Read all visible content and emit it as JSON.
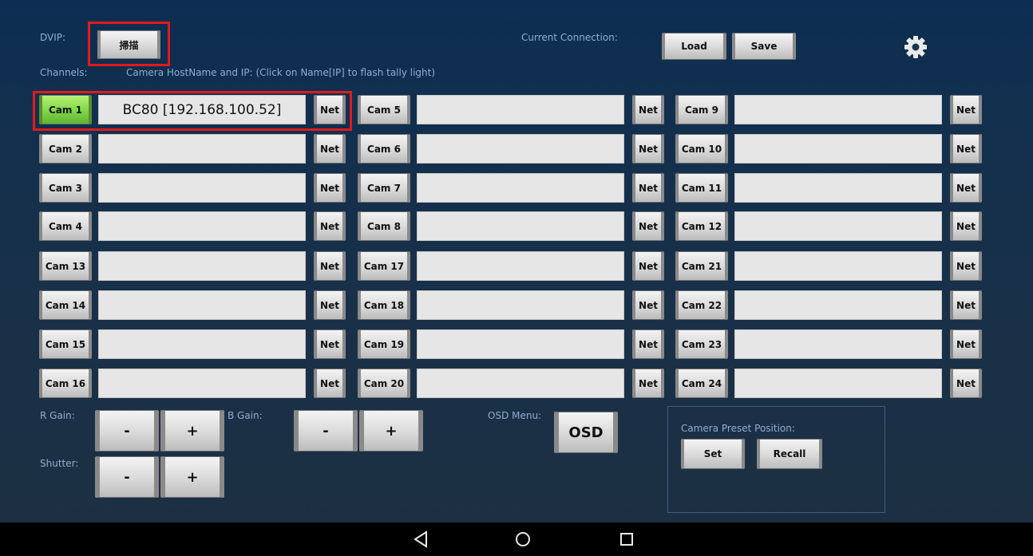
{
  "top": {
    "dvip_label": "DVIP:",
    "scan_label": "掃描",
    "current_connection_label": "Current Connection:",
    "load_label": "Load",
    "save_label": "Save",
    "channels_label": "Channels:",
    "hint_text": "Camera HostName and IP: (Click on Name[IP] to flash tally light)",
    "settings_icon": "gear-icon"
  },
  "net_label": "Net",
  "cameras": [
    {
      "label": "Cam 1",
      "name": "BC80 [192.168.100.52]",
      "active": true
    },
    {
      "label": "Cam 2",
      "name": ""
    },
    {
      "label": "Cam 3",
      "name": ""
    },
    {
      "label": "Cam 4",
      "name": ""
    },
    {
      "label": "Cam 5",
      "name": ""
    },
    {
      "label": "Cam 6",
      "name": ""
    },
    {
      "label": "Cam 7",
      "name": ""
    },
    {
      "label": "Cam 8",
      "name": ""
    },
    {
      "label": "Cam 9",
      "name": ""
    },
    {
      "label": "Cam 10",
      "name": ""
    },
    {
      "label": "Cam 11",
      "name": ""
    },
    {
      "label": "Cam 12",
      "name": ""
    },
    {
      "label": "Cam 13",
      "name": ""
    },
    {
      "label": "Cam 14",
      "name": ""
    },
    {
      "label": "Cam 15",
      "name": ""
    },
    {
      "label": "Cam 16",
      "name": ""
    },
    {
      "label": "Cam 17",
      "name": ""
    },
    {
      "label": "Cam 18",
      "name": ""
    },
    {
      "label": "Cam 19",
      "name": ""
    },
    {
      "label": "Cam 20",
      "name": ""
    },
    {
      "label": "Cam 21",
      "name": ""
    },
    {
      "label": "Cam 22",
      "name": ""
    },
    {
      "label": "Cam 23",
      "name": ""
    },
    {
      "label": "Cam 24",
      "name": ""
    }
  ],
  "controls": {
    "r_gain_label": "R Gain:",
    "b_gain_label": "B Gain:",
    "shutter_label": "Shutter:",
    "minus": "-",
    "plus": "+",
    "osd_menu_label": "OSD Menu:",
    "osd_button": "OSD",
    "preset_label": "Camera Preset Position:",
    "set_label": "Set",
    "recall_label": "Recall"
  },
  "navbar": {
    "icons": [
      "back-icon",
      "home-icon",
      "recents-icon"
    ]
  },
  "colors": {
    "active_camera": "#7fd64a",
    "highlight": "#e21a1a",
    "label_text": "#8eaed0"
  }
}
